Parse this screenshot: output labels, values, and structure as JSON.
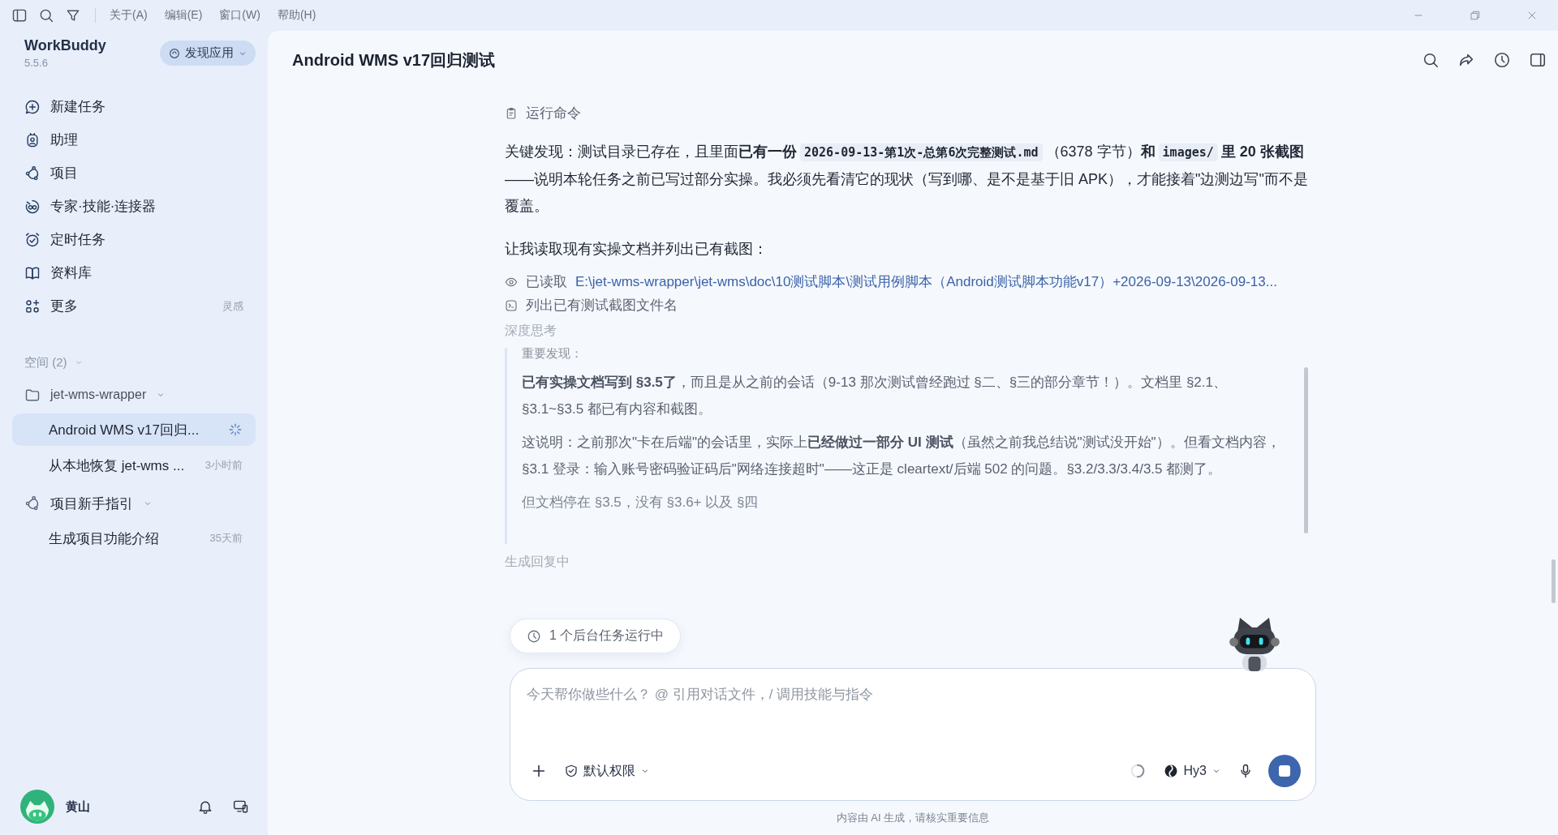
{
  "menu_bar": {
    "items": [
      "关于(A)",
      "编辑(E)",
      "窗口(W)",
      "帮助(H)"
    ]
  },
  "sidebar": {
    "app_name": "WorkBuddy",
    "version": "5.5.6",
    "discover_button": "发现应用",
    "nav_items": [
      {
        "label": "新建任务"
      },
      {
        "label": "助理"
      },
      {
        "label": "项目"
      },
      {
        "label": "专家·技能·连接器"
      },
      {
        "label": "定时任务"
      },
      {
        "label": "资料库"
      },
      {
        "label": "更多",
        "hint": "灵感"
      }
    ],
    "spaces": {
      "label": "空间 (2)",
      "expanded": true
    },
    "groups": [
      {
        "kind": "folder",
        "name": "jet-wms-wrapper",
        "expanded": true,
        "tasks": [
          {
            "title": "Android WMS v17回归...",
            "selected": true,
            "running": true
          },
          {
            "title": "从本地恢复 jet-wms ...",
            "time": "3小时前",
            "selected": false,
            "running": false
          }
        ]
      },
      {
        "kind": "project",
        "name": "项目新手指引",
        "expanded": true,
        "tasks": [
          {
            "title": "生成项目功能介绍",
            "time": "35天前",
            "selected": false,
            "running": false
          }
        ]
      }
    ],
    "user": {
      "name": "黄山"
    }
  },
  "main": {
    "title": "Android WMS v17回归测试",
    "stream": [
      {
        "kind": "command",
        "text": "运行命令"
      },
      {
        "kind": "paragraph",
        "segments": [
          {
            "kind": "text",
            "text": "关键发现：测试目录已存在，且里面"
          },
          {
            "kind": "bold",
            "text": "已有一份"
          },
          {
            "kind": "code",
            "text": "2026-09-13-第1次-总第6次完整测试.md"
          },
          {
            "kind": "text",
            "text": "（6378 字节）"
          },
          {
            "kind": "bold",
            "text": "和"
          },
          {
            "kind": "code",
            "text": "images/"
          },
          {
            "kind": "bold",
            "text": "里 20 张截图"
          },
          {
            "kind": "text",
            "text": "——说明本轮任务之前已写过部分实操。我必须先看清它的现状（写到哪、是不是基于旧 APK），才能接着\"边测边写\"而不是覆盖。"
          }
        ]
      },
      {
        "kind": "paragraph",
        "segments": [
          {
            "kind": "text",
            "text": "让我读取现有实操文档并列出已有截图："
          }
        ]
      },
      {
        "kind": "read",
        "text": "已读取",
        "path": "E:\\jet-wms-wrapper\\jet-wms\\doc\\10测试脚本\\测试用例脚本（Android测试脚本功能v17）+2026-09-13\\2026-09-13..."
      },
      {
        "kind": "list",
        "text": "列出已有测试截图文件名"
      },
      {
        "kind": "label",
        "text": "深度思考"
      },
      {
        "kind": "thinking",
        "paragraphs": [
          "重要发现：",
          "**已有实操文档写到 §3.5了**，而且是从之前的会话（9-13 那次测试曾经跑过 §二、§三的部分章节！）。文档里 §2.1、§3.1~§3.5 都已有内容和截图。",
          "这说明：之前那次\"卡在后端\"的会话里，实际上**已经做过一部分 UI 测试**（虽然之前我总结说\"测试没开始\"）。但看文档内容，§3.1 登录：输入账号密码验证码后\"网络连接超时\"——这正是 cleartext/后端 502 的问题。§3.2/3.3/3.4/3.5 都测了。",
          "但文档停在 §3.5，没有 §3.6+ 以及 §四"
        ]
      },
      {
        "kind": "label",
        "text": "生成回复中"
      }
    ],
    "background_tasks": "1 个后台任务运行中",
    "composer": {
      "placeholder": "今天帮你做些什么？ @ 引用对话文件，/ 调用技能与指令",
      "permission": "默认权限",
      "model": "Hy3",
      "busy": true
    },
    "footer_note": "内容由 AI 生成，请核实重要信息"
  }
}
